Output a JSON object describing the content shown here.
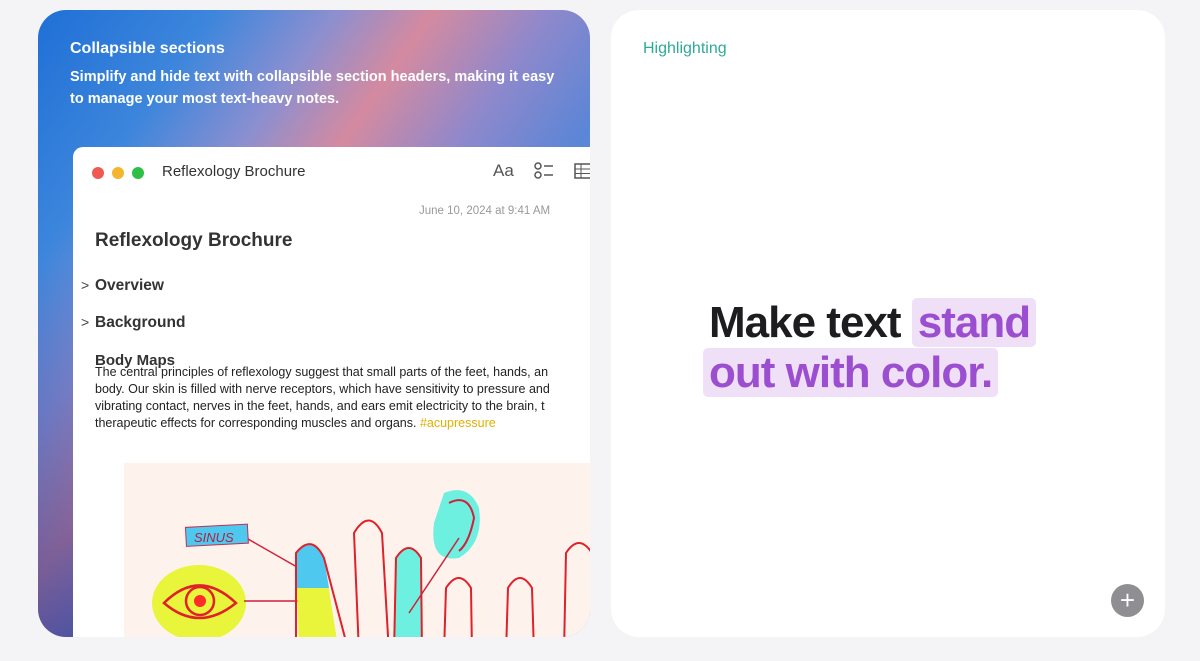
{
  "left_card": {
    "title": "Collapsible sections",
    "description": "Simplify and hide text with collapsible section headers, making it easy to manage your most text-heavy notes."
  },
  "notes_window": {
    "window_title": "Reflexology Brochure",
    "toolbar": {
      "format_label": "Aa",
      "checklist_icon": "checklist-icon",
      "table_icon": "table-icon"
    },
    "date": "June 10, 2024 at 9:41 AM",
    "note_title": "Reflexology Brochure",
    "sections": [
      {
        "label": "Overview",
        "collapsed": true
      },
      {
        "label": "Background",
        "collapsed": true
      }
    ],
    "body_heading": "Body Maps",
    "body_lines": [
      "The central principles of reflexology suggest that small parts of the feet, hands, an",
      "body. Our skin is filled with nerve receptors, which have sensitivity to pressure and",
      "vibrating contact, nerves in the feet, hands, and ears emit electricity to the brain, t",
      "therapeutic effects for corresponding muscles and organs. "
    ],
    "hashtag": "#acupressure",
    "illustration_label": "SINUS"
  },
  "right_card": {
    "title": "Highlighting",
    "plain_text": "Make text",
    "highlight_1": "stand",
    "highlight_2": "out with color.",
    "add_button": "+"
  },
  "colors": {
    "accent_teal": "#2eaa98",
    "highlight_text": "#9b4fd0",
    "highlight_bg": "#efe0f7",
    "hashtag": "#e0b000"
  }
}
